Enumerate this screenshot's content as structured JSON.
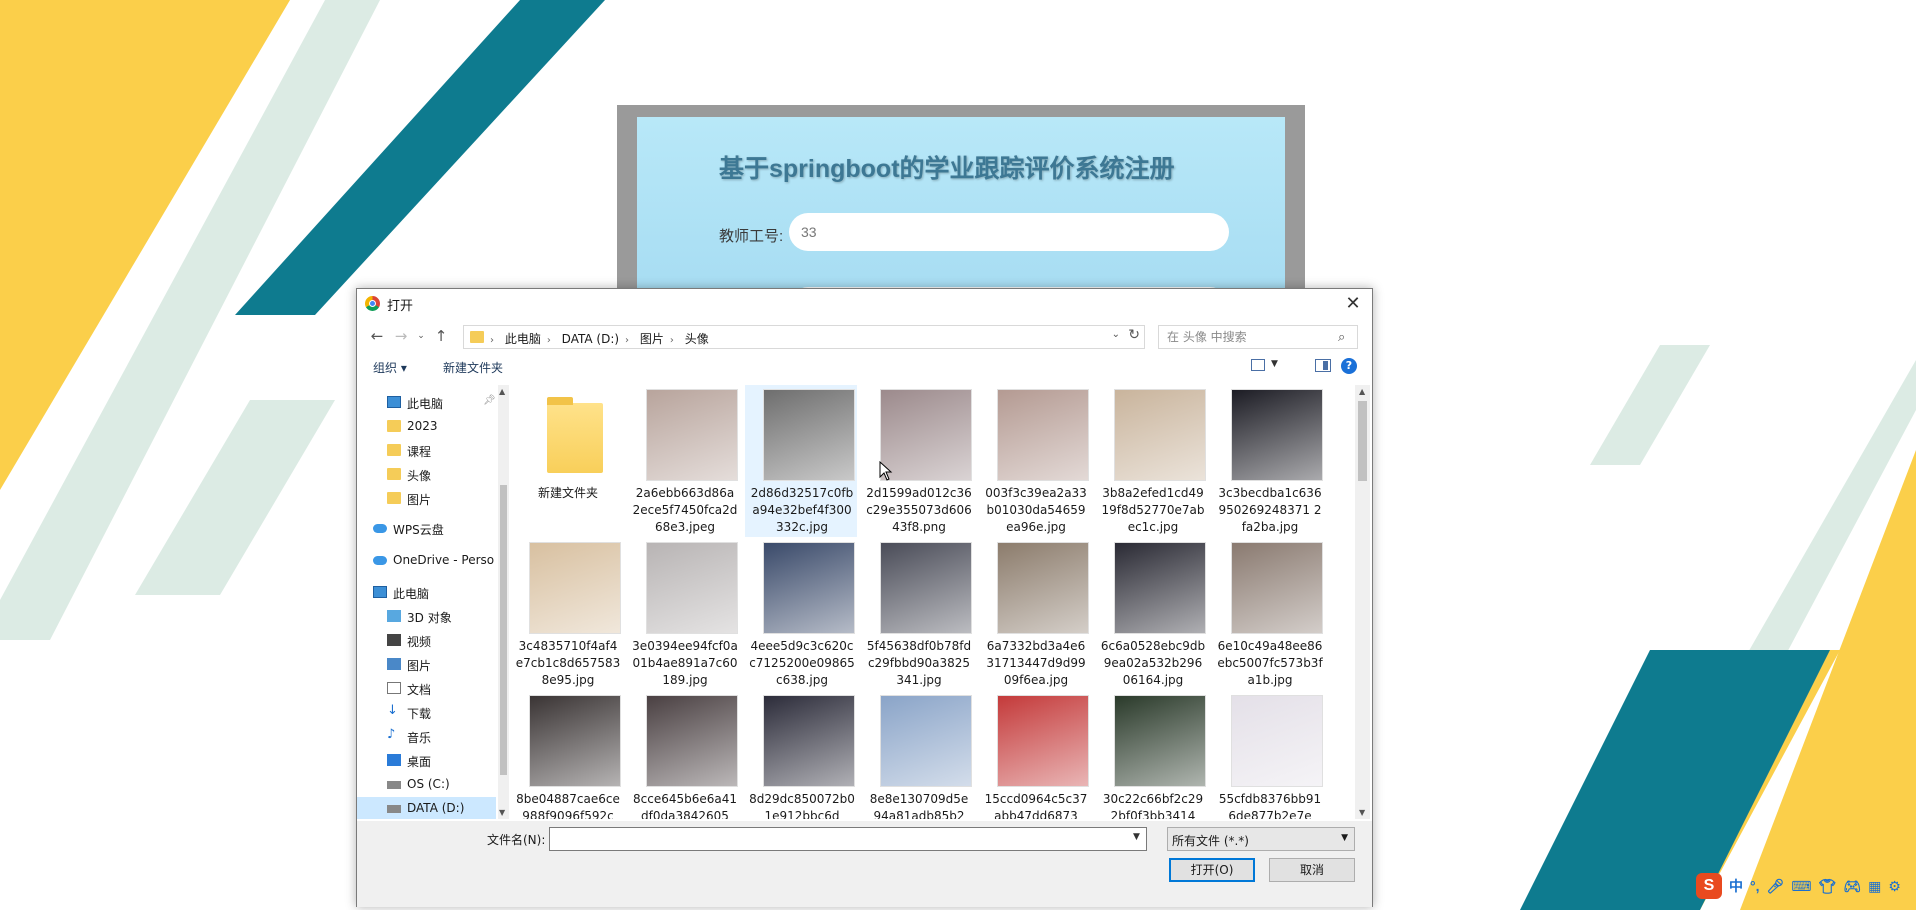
{
  "registration": {
    "title": "基于springboot的学业跟踪评价系统注册",
    "teacher_id_label": "教师工号:",
    "teacher_id_value": "33"
  },
  "dialog": {
    "title": "打开",
    "breadcrumb": [
      "此电脑",
      "DATA (D:)",
      "图片",
      "头像"
    ],
    "search_placeholder": "在 头像 中搜索",
    "toolbar": {
      "organize": "组织 ▾",
      "new_folder": "新建文件夹"
    },
    "nav": [
      {
        "label": "此电脑",
        "icon": "pc-icon",
        "pinned": true
      },
      {
        "label": "2023",
        "icon": "folder-icon"
      },
      {
        "label": "课程",
        "icon": "folder-icon"
      },
      {
        "label": "头像",
        "icon": "folder-icon"
      },
      {
        "label": "图片",
        "icon": "folder-icon"
      },
      {
        "label": "WPS云盘",
        "icon": "cloud-icon"
      },
      {
        "label": "OneDrive - Perso",
        "icon": "onedrive-icon"
      },
      {
        "label": "此电脑",
        "icon": "pc-icon"
      },
      {
        "label": "3D 对象",
        "icon": "3d-objects-icon"
      },
      {
        "label": "视频",
        "icon": "video-icon"
      },
      {
        "label": "图片",
        "icon": "pictures-icon"
      },
      {
        "label": "文档",
        "icon": "documents-icon"
      },
      {
        "label": "下载",
        "icon": "download-icon"
      },
      {
        "label": "音乐",
        "icon": "music-icon"
      },
      {
        "label": "桌面",
        "icon": "desktop-icon"
      },
      {
        "label": "OS (C:)",
        "icon": "drive-icon"
      },
      {
        "label": "DATA (D:)",
        "icon": "drive-icon",
        "selected": true
      }
    ],
    "files": [
      {
        "name": "新建文件夹",
        "type": "folder"
      },
      {
        "name": "2a6ebb663d86a2ece5f7450fca2d68e3.jpeg",
        "type": "image",
        "tone": "#b8a49c"
      },
      {
        "name": "2d86d32517c0fba94e32bef4f300332c.jpg",
        "type": "image",
        "tone": "#6e6e6e",
        "selected": true
      },
      {
        "name": "2d1599ad012c36c29e355073d60643f8.png",
        "type": "image",
        "tone": "#9c8a8c"
      },
      {
        "name": "003f3c39ea2a33b01030da54659ea96e.jpg",
        "type": "image",
        "tone": "#b49a92"
      },
      {
        "name": "3b8a2efed1cd4919f8d52770e7abec1c.jpg",
        "type": "image",
        "tone": "#c9b49c"
      },
      {
        "name": "3c3becdba1c636950269248371 2fa2ba.jpg",
        "type": "image",
        "tone": "#1c1c24"
      },
      {
        "name": "3c4835710f4af4e7cb1c8d6575838e95.jpg",
        "type": "image",
        "tone": "#d8c0a0"
      },
      {
        "name": "3e0394ee94fcf0a01b4ae891a7c60189.jpg",
        "type": "image",
        "tone": "#b8b4b4"
      },
      {
        "name": "4eee5d9c3c620cc7125200e09865c638.jpg",
        "type": "image",
        "tone": "#3a4a6a"
      },
      {
        "name": "5f45638df0b78fdc29fbbd90a3825341.jpg",
        "type": "image",
        "tone": "#4a4c58"
      },
      {
        "name": "6a7332bd3a4e631713447d9d9909f6ea.jpg",
        "type": "image",
        "tone": "#8c7c6c"
      },
      {
        "name": "6c6a0528ebc9db9ea02a532b29606164.jpg",
        "type": "image",
        "tone": "#2a2a34"
      },
      {
        "name": "6e10c49a48ee86ebc5007fc573b3fa1b.jpg",
        "type": "image",
        "tone": "#8a7a70"
      },
      {
        "name": "8be04887cae6ce988f9096f592c",
        "type": "image",
        "tone": "#3a3434"
      },
      {
        "name": "8cce645b6e6a41df0da3842605",
        "type": "image",
        "tone": "#4a4042"
      },
      {
        "name": "8d29dc850072b01e912bbc6d",
        "type": "image",
        "tone": "#2c2c3a"
      },
      {
        "name": "8e8e130709d5e94a81adb85b2",
        "type": "image",
        "tone": "#8aa4c8"
      },
      {
        "name": "15ccd0964c5c37abb47dd6873",
        "type": "image",
        "tone": "#c43a3a"
      },
      {
        "name": "30c22c66bf2c292bf0f3bb3414",
        "type": "image",
        "tone": "#2a3a2a"
      },
      {
        "name": "55cfdb8376bb916de877b2e7e",
        "type": "image",
        "tone": "#e4e0e8"
      }
    ],
    "filename_label": "文件名(N):",
    "filename_value": "",
    "filter_value": "所有文件 (*.*)",
    "open_button": "打开(O)",
    "cancel_button": "取消"
  },
  "ime": {
    "logo": "S",
    "lang": "中",
    "punct": "°,"
  },
  "colors": {
    "accent_teal": "#0e7b8f",
    "accent_yellow": "#fbcf4a",
    "selection": "#cce8ff"
  }
}
